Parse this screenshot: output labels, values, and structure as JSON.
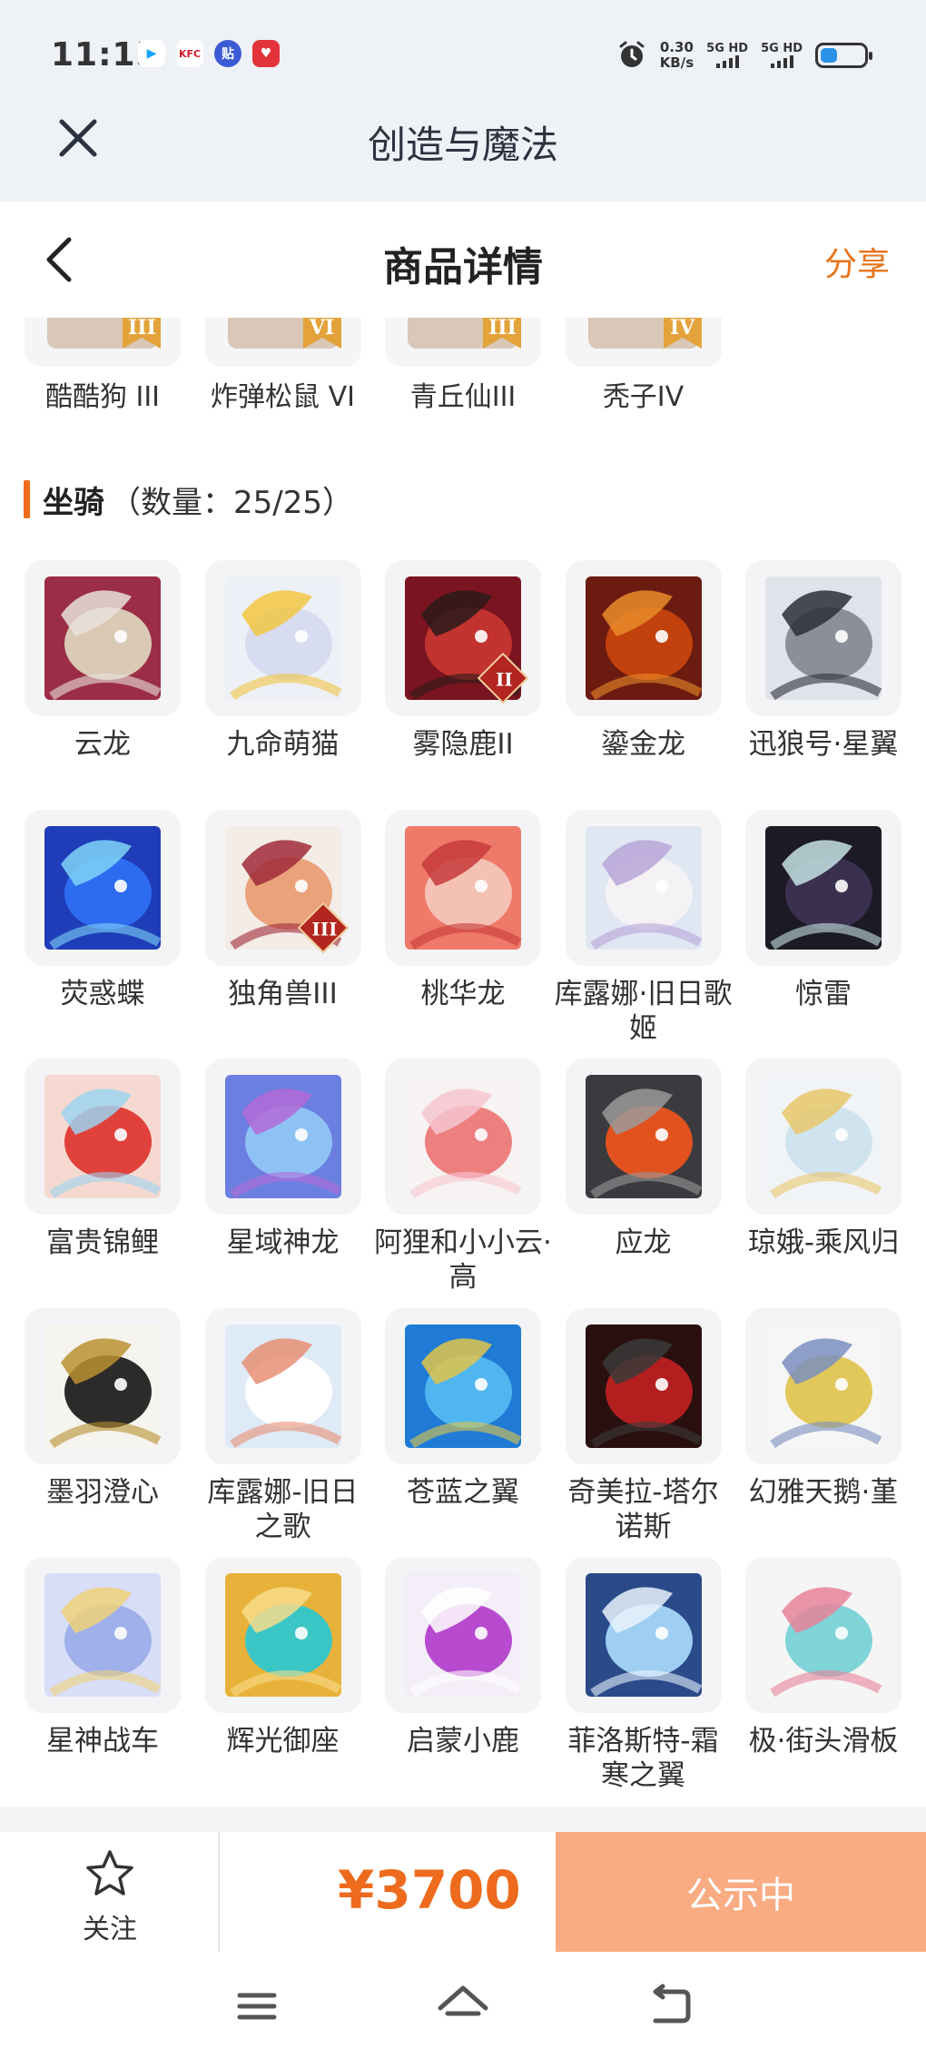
{
  "status_bar": {
    "time": "11:15",
    "apps": [
      {
        "icon": "video-app-icon",
        "color": "#ffffff",
        "text": "▶"
      },
      {
        "icon": "kfc-app-icon",
        "color": "#ffffff",
        "text": "KFC"
      },
      {
        "icon": "tieba-app-icon",
        "color": "#3b5bd6",
        "text": "贴"
      },
      {
        "icon": "heart-app-icon",
        "color": "#e2333a",
        "text": "♥"
      }
    ],
    "net_speed_value": "0.30",
    "net_speed_unit": "KB/s",
    "sim1": "5G HD",
    "sim2": "5G HD"
  },
  "app_bar": {
    "title": "创造与魔法"
  },
  "page_header": {
    "title": "商品详情",
    "share_label": "分享"
  },
  "prev_items": [
    {
      "label": "酷酷狗 III",
      "badge": "III"
    },
    {
      "label": "炸弹松鼠 VI",
      "badge": "VI"
    },
    {
      "label": "青丘仙III",
      "badge": "III"
    },
    {
      "label": "秃子IV",
      "badge": "IV"
    }
  ],
  "section": {
    "name": "坐骑",
    "count": "（数量：25/25）"
  },
  "mounts": [
    {
      "label": "云龙",
      "colors": [
        "#9b2d46",
        "#d9c9b5",
        "#e7e2dc"
      ],
      "badge": ""
    },
    {
      "label": "九命萌猫",
      "colors": [
        "#eef0f7",
        "#d8dcf0",
        "#f2c542"
      ],
      "badge": ""
    },
    {
      "label": "雾隐鹿II",
      "colors": [
        "#7a1420",
        "#c2332f",
        "#2b1a1a"
      ],
      "badge": "II"
    },
    {
      "label": "鎏金龙",
      "colors": [
        "#6b1b10",
        "#c2410c",
        "#e98c2a"
      ],
      "badge": ""
    },
    {
      "label": "迅狼号·星翼",
      "colors": [
        "#dfe3ea",
        "#8a8f99",
        "#2d3036"
      ],
      "badge": ""
    },
    {
      "label": "荧惑蝶",
      "colors": [
        "#1f3db8",
        "#2d6cf0",
        "#7fd4f7"
      ],
      "badge": ""
    },
    {
      "label": "独角兽III",
      "colors": [
        "#f4ece6",
        "#e9a27a",
        "#a02a3a"
      ],
      "badge": "III"
    },
    {
      "label": "桃华龙",
      "colors": [
        "#f07a6a",
        "#f5c1b5",
        "#c63a3a"
      ],
      "badge": ""
    },
    {
      "label": "库露娜·旧日歌姬",
      "colors": [
        "#dfe7f3",
        "#f5f2f6",
        "#b9a4d8"
      ],
      "badge": ""
    },
    {
      "label": "惊雷",
      "colors": [
        "#1c1a24",
        "#3a3050",
        "#c6e3e3"
      ],
      "badge": ""
    },
    {
      "label": "富贵锦鲤",
      "colors": [
        "#f5d9d0",
        "#e0413a",
        "#9ed3f0"
      ],
      "badge": ""
    },
    {
      "label": "星域神龙",
      "colors": [
        "#6b7fe0",
        "#8fc2f4",
        "#b46ad8"
      ],
      "badge": ""
    },
    {
      "label": "阿狸和小小云·高",
      "colors": [
        "#f7f3f3",
        "#ee7f7f",
        "#f6c6d0"
      ],
      "badge": ""
    },
    {
      "label": "应龙",
      "colors": [
        "#3b3b3f",
        "#e2521f",
        "#9a9a9a"
      ],
      "badge": ""
    },
    {
      "label": "琼娥-乘风归",
      "colors": [
        "#f1f4f7",
        "#cfe4ef",
        "#e9c76a"
      ],
      "badge": ""
    },
    {
      "label": "墨羽澄心",
      "colors": [
        "#f6f4ef",
        "#2c2b2a",
        "#b8902f"
      ],
      "badge": ""
    },
    {
      "label": "库露娜-旧日之歌",
      "colors": [
        "#dfeaf7",
        "#ffffff",
        "#e88f74"
      ],
      "badge": ""
    },
    {
      "label": "苍蓝之翼",
      "colors": [
        "#1f7bd6",
        "#4fb6f0",
        "#e0c64a"
      ],
      "badge": ""
    },
    {
      "label": "奇美拉-塔尔诺斯",
      "colors": [
        "#2a0f0f",
        "#b31f1f",
        "#3a3a3a"
      ],
      "badge": ""
    },
    {
      "label": "幻雅天鹅·堇",
      "colors": [
        "#f6f6f6",
        "#e2c75a",
        "#7a8fc0"
      ],
      "badge": ""
    },
    {
      "label": "星神战车",
      "colors": [
        "#d8def7",
        "#9fb0ea",
        "#f0d27a"
      ],
      "badge": ""
    },
    {
      "label": "辉光御座",
      "colors": [
        "#e8b23a",
        "#3bc6c6",
        "#f7dc8a"
      ],
      "badge": ""
    },
    {
      "label": "启蒙小鹿",
      "colors": [
        "#f3eef7",
        "#b84ad0",
        "#ffffff"
      ],
      "badge": ""
    },
    {
      "label": "菲洛斯特-霜寒之翼",
      "colors": [
        "#2a4a8a",
        "#9ecff2",
        "#e7f2fb"
      ],
      "badge": ""
    },
    {
      "label": "极·街头滑板",
      "colors": [
        "#f5f5f5",
        "#7fd4d8",
        "#e8829a"
      ],
      "badge": ""
    }
  ],
  "action_bar": {
    "follow_label": "关注",
    "price": "¥3700",
    "status_label": "公示中"
  },
  "colors": {
    "accent": "#ee6b1d",
    "button_bg": "#f9ab82",
    "header_bg": "#eef1f6"
  }
}
